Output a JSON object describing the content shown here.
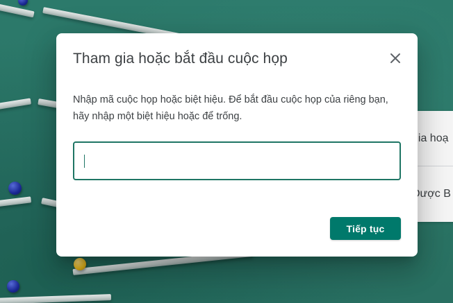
{
  "background": {
    "accent_color": "#2f7a6c",
    "side_panel": {
      "items": [
        {
          "label": "gia hoạ"
        },
        {
          "label": "Dược B"
        }
      ]
    }
  },
  "dialog": {
    "title": "Tham gia hoặc bắt đầu cuộc họp",
    "close_icon": "close-icon",
    "description": "Nhập mã cuộc họp hoặc biệt hiệu. Để bắt đầu cuộc họp của riêng bạn, hãy nhập một biệt hiệu hoặc để trống.",
    "input": {
      "value": "",
      "placeholder": ""
    },
    "continue_label": "Tiếp tục",
    "primary_color": "#00796b"
  }
}
